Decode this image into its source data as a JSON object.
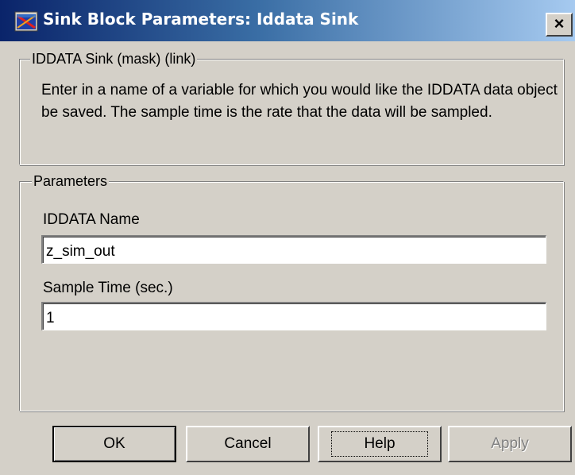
{
  "window": {
    "title": "Sink Block Parameters: Iddata Sink",
    "close_glyph": "×",
    "icon": "simulink-block-icon"
  },
  "mask_group": {
    "legend": "IDDATA Sink (mask) (link)",
    "description": "Enter in a name of a variable for which you would like the IDDATA data object be saved.  The sample time is the rate that the data will be sampled."
  },
  "parameters_group": {
    "legend": "Parameters",
    "iddata_name": {
      "label": "IDDATA Name",
      "value": "z_sim_out"
    },
    "sample_time": {
      "label": "Sample Time (sec.)",
      "value": "1"
    }
  },
  "buttons": {
    "ok": "OK",
    "cancel": "Cancel",
    "help": "Help",
    "apply": "Apply"
  }
}
